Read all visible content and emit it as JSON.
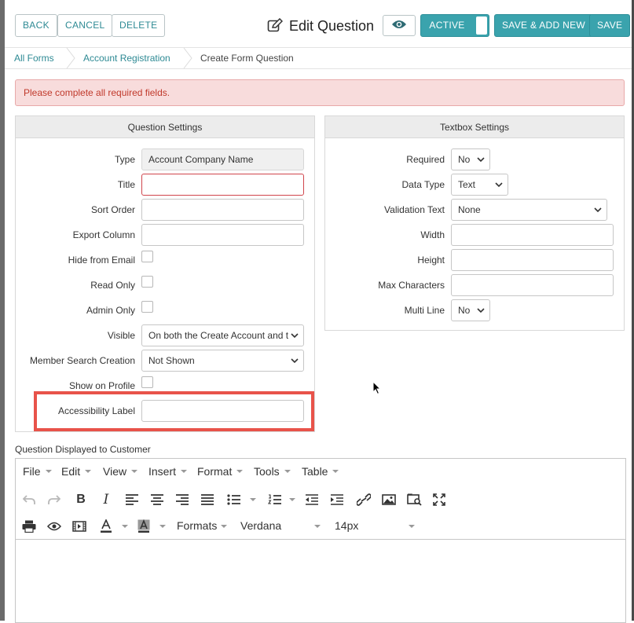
{
  "toolbar": {
    "back_label": "BACK",
    "cancel_label": "CANCEL",
    "delete_label": "DELETE",
    "title": "Edit Question",
    "active_label": "ACTIVE",
    "save_add_new_label": "SAVE & ADD NEW",
    "save_label": "SAVE"
  },
  "breadcrumb": [
    "All Forms",
    "Account Registration",
    "Create Form Question"
  ],
  "alert": {
    "message": "Please complete all required fields."
  },
  "question_settings": {
    "heading": "Question Settings",
    "fields": {
      "type": {
        "label": "Type",
        "value": "Account Company Name"
      },
      "title": {
        "label": "Title",
        "value": ""
      },
      "sort_order": {
        "label": "Sort Order",
        "value": ""
      },
      "export_column": {
        "label": "Export Column",
        "value": ""
      },
      "hide_from_email": {
        "label": "Hide from Email",
        "checked": false
      },
      "read_only": {
        "label": "Read Only",
        "checked": false
      },
      "admin_only": {
        "label": "Admin Only",
        "checked": false
      },
      "visible": {
        "label": "Visible",
        "value": "On both the Create Account and t"
      },
      "member_search_creation": {
        "label": "Member Search Creation",
        "value": "Not Shown"
      },
      "show_on_profile": {
        "label": "Show on Profile",
        "checked": false
      },
      "accessibility_label": {
        "label": "Accessibility Label",
        "value": ""
      }
    }
  },
  "textbox_settings": {
    "heading": "Textbox Settings",
    "fields": {
      "required": {
        "label": "Required",
        "value": "No"
      },
      "data_type": {
        "label": "Data Type",
        "value": "Text"
      },
      "validation_text": {
        "label": "Validation Text",
        "value": "None"
      },
      "width": {
        "label": "Width",
        "value": ""
      },
      "height": {
        "label": "Height",
        "value": ""
      },
      "max_characters": {
        "label": "Max Characters",
        "value": ""
      },
      "multi_line": {
        "label": "Multi Line",
        "value": "No"
      }
    }
  },
  "editor": {
    "label": "Question Displayed to Customer",
    "menus": [
      "File",
      "Edit",
      "View",
      "Insert",
      "Format",
      "Tools",
      "Table"
    ],
    "formats_label": "Formats",
    "font_family": "Verdana",
    "font_size": "14px"
  },
  "colors": {
    "accent": "#3aa3ad",
    "link": "#2e8a94",
    "alert_bg": "#f8dcdc",
    "alert_text": "#c0392b",
    "highlight_border": "#e8534a"
  }
}
